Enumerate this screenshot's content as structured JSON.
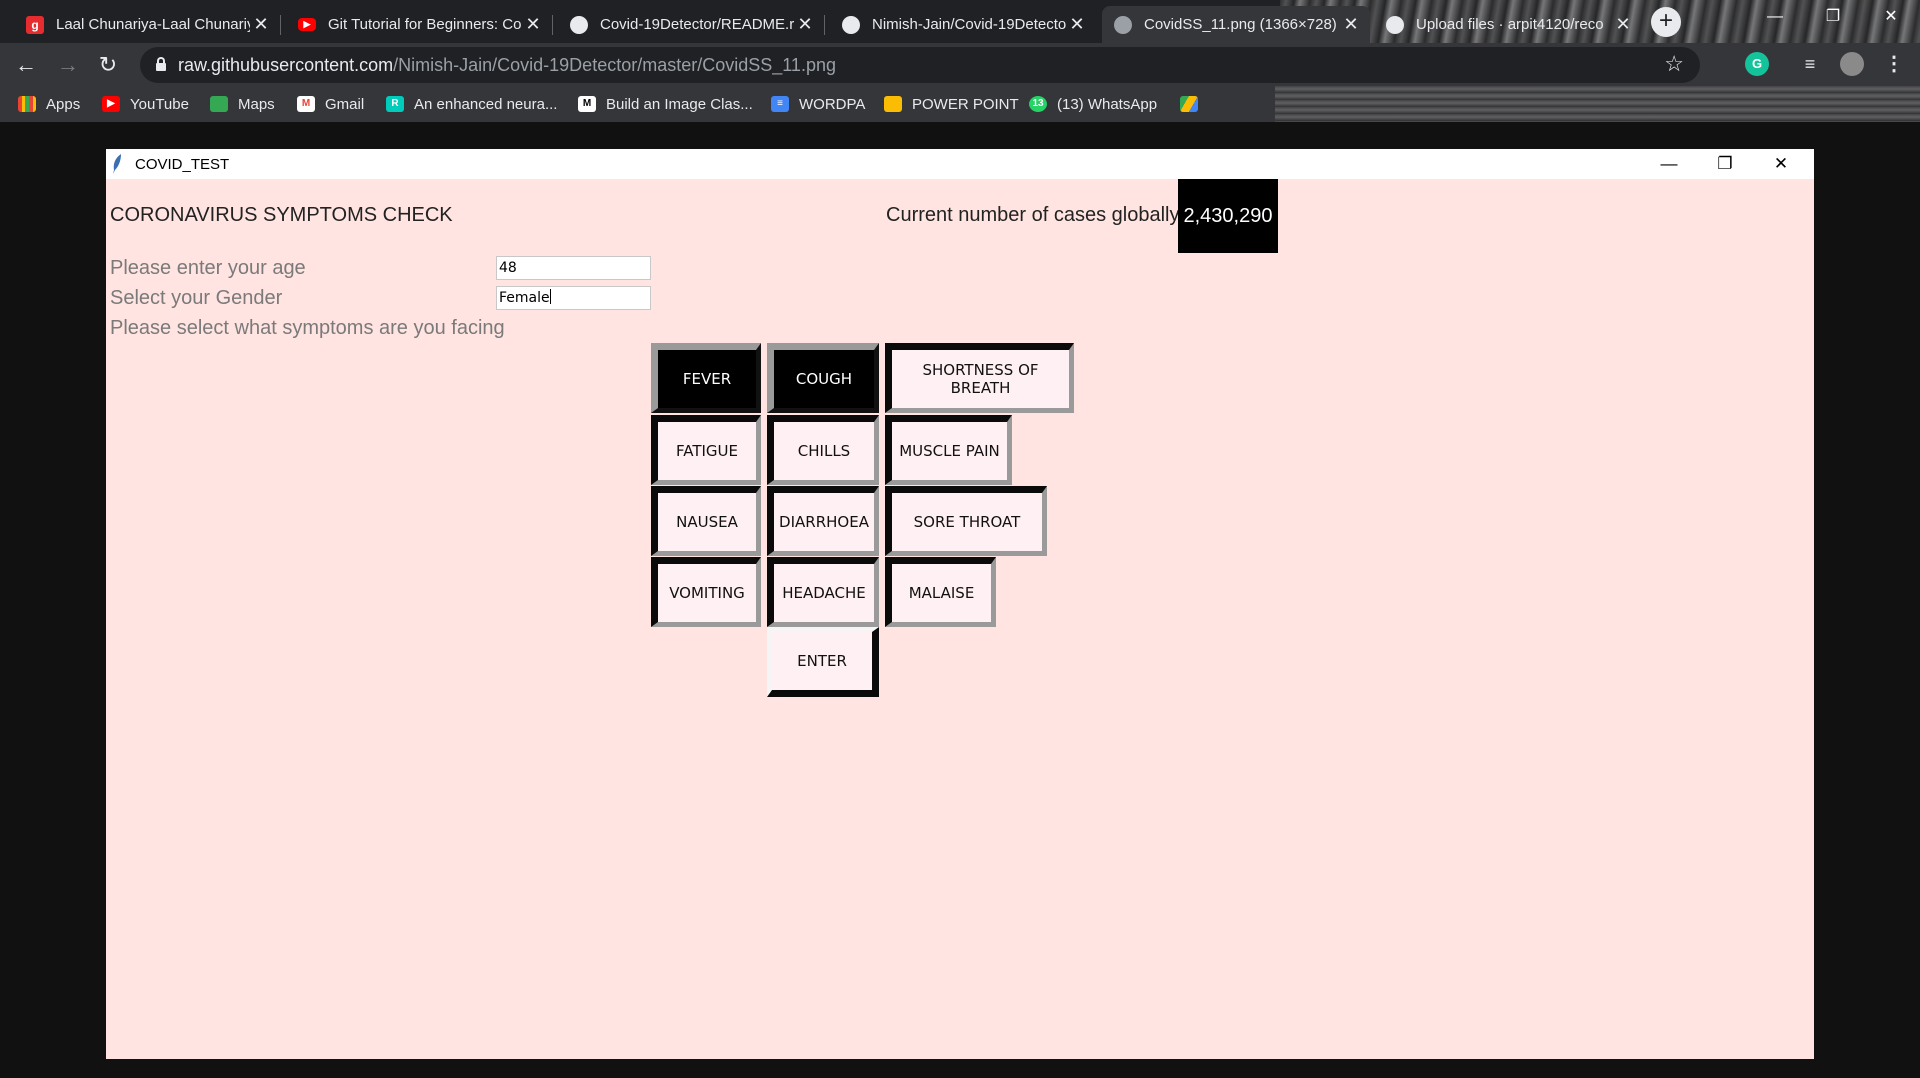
{
  "browser": {
    "tabs": [
      {
        "title": "Laal Chunariya-Laal Chunariy",
        "icon": "gaana-icon",
        "color": "#e72c30",
        "glyph": "g"
      },
      {
        "title": "Git Tutorial for Beginners: Co",
        "icon": "youtube-icon",
        "color": "#ff0000",
        "glyph": "▶"
      },
      {
        "title": "Covid-19Detector/README.r",
        "icon": "github-icon",
        "color": "#e8eaed",
        "glyph": ""
      },
      {
        "title": "Nimish-Jain/Covid-19Detecto",
        "icon": "github-icon",
        "color": "#e8eaed",
        "glyph": ""
      },
      {
        "title": "CovidSS_11.png (1366×728)",
        "icon": "globe-icon",
        "color": "#9aa0a6",
        "glyph": ""
      },
      {
        "title": "Upload files · arpit4120/reco",
        "icon": "github-icon",
        "color": "#e8eaed",
        "glyph": ""
      }
    ],
    "url_domain": "raw.githubusercontent.com",
    "url_path": "/Nimish-Jain/Covid-19Detector/master/CovidSS_11.png",
    "bookmarks": [
      {
        "label": "Apps",
        "icon": "apps-grid-icon",
        "color": "#ea4335"
      },
      {
        "label": "YouTube",
        "icon": "youtube-icon",
        "color": "#ff0000"
      },
      {
        "label": "Maps",
        "icon": "maps-icon",
        "color": "#34a853"
      },
      {
        "label": "Gmail",
        "icon": "gmail-icon",
        "color": "#ea4335"
      },
      {
        "label": "An enhanced neura...",
        "icon": "researchgate-icon",
        "color": "#00ccbb"
      },
      {
        "label": "Build an Image Clas...",
        "icon": "medium-icon",
        "color": "#ffffff"
      },
      {
        "label": "WORDPA",
        "icon": "docs-icon",
        "color": "#4285f4"
      },
      {
        "label": "POWER POINT",
        "icon": "slides-icon",
        "color": "#fbbc04"
      },
      {
        "label": "(13) WhatsApp",
        "icon": "whatsapp-icon",
        "color": "#25d366"
      },
      {
        "label": "",
        "icon": "google-drive-icon",
        "color": "#fbbc04"
      }
    ]
  },
  "app": {
    "window_title": "COVID_TEST",
    "heading": "CORONAVIRUS SYMPTOMS CHECK",
    "cases_label": "Current number of cases globally:",
    "cases_value": "2,430,290",
    "age_label": "Please enter your age",
    "age_value": "48",
    "gender_label": "Select your Gender",
    "gender_value": "Female",
    "symptoms_prompt": "Please select what symptoms are you facing",
    "symptoms": [
      {
        "label": "FEVER",
        "selected": true
      },
      {
        "label": "COUGH",
        "selected": true
      },
      {
        "label": "SHORTNESS OF BREATH",
        "selected": false
      },
      {
        "label": "FATIGUE",
        "selected": false
      },
      {
        "label": "CHILLS",
        "selected": false
      },
      {
        "label": "MUSCLE PAIN",
        "selected": false
      },
      {
        "label": "NAUSEA",
        "selected": false
      },
      {
        "label": "DIARRHOEA",
        "selected": false
      },
      {
        "label": "SORE THROAT",
        "selected": false
      },
      {
        "label": "VOMITING",
        "selected": false
      },
      {
        "label": "HEADACHE",
        "selected": false
      },
      {
        "label": "MALAISE",
        "selected": false
      }
    ],
    "enter_label": "ENTER",
    "colors": {
      "background": "#ffe4e1",
      "button": "#fff0f3",
      "selected": "#000000"
    }
  }
}
